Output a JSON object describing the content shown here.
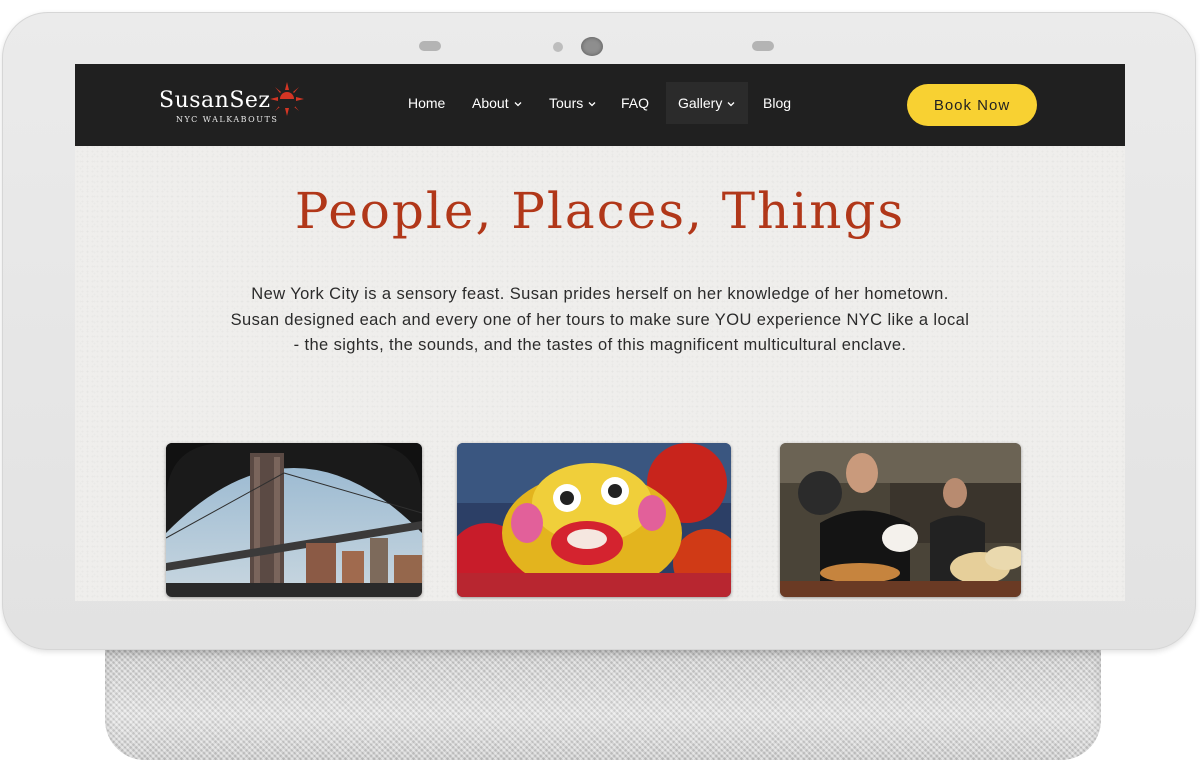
{
  "brand": {
    "name": "SusanSez",
    "tagline": "NYC WALKABOUTS",
    "accent_color": "#b13719",
    "logo_icon": "sun-icon"
  },
  "nav": {
    "items": [
      {
        "label": "Home",
        "has_dropdown": false
      },
      {
        "label": "About",
        "has_dropdown": true
      },
      {
        "label": "Tours",
        "has_dropdown": true
      },
      {
        "label": "FAQ",
        "has_dropdown": false
      },
      {
        "label": "Gallery",
        "has_dropdown": true,
        "active": true
      },
      {
        "label": "Blog",
        "has_dropdown": false
      }
    ],
    "cta_label": "Book Now",
    "cta_color": "#f8d132",
    "background": "#202020"
  },
  "hero": {
    "title": "People, Places, Things",
    "intro": "New York City is a sensory feast. Susan prides herself on her knowledge of her hometown. Susan designed each and every one of her tours to make sure YOU experience NYC like a local -  the sights, the sounds, and the tastes of this magnificent multicultural enclave."
  },
  "gallery": {
    "photos": [
      {
        "subject": "bridge-photo"
      },
      {
        "subject": "lion-dance-photo"
      },
      {
        "subject": "bakers-photo"
      }
    ]
  }
}
